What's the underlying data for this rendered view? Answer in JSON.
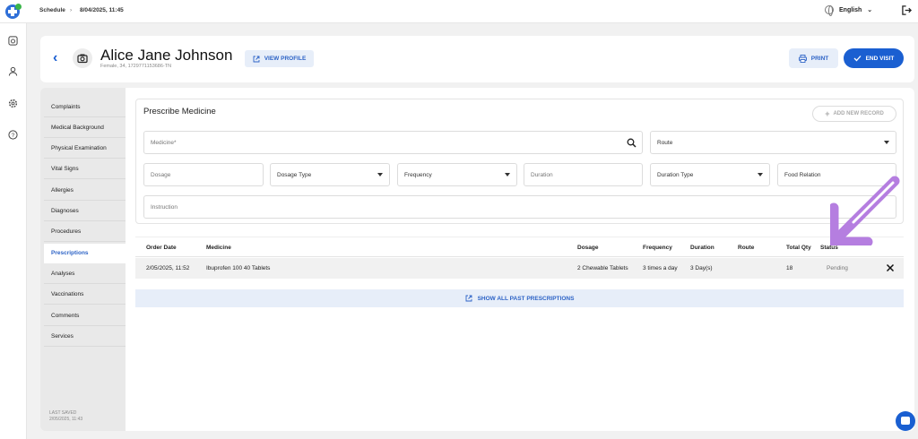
{
  "topbar": {
    "crumb_root": "Schedule",
    "crumb_sep": "›",
    "crumb_current": "8/04/2025, 11:45",
    "language": "English",
    "icons": [
      "app-logo",
      "globe-icon",
      "chevron-down-icon",
      "logout-icon"
    ]
  },
  "rail": {
    "icons": [
      "calendar-icon",
      "user-icon",
      "settings-icon",
      "help-icon"
    ]
  },
  "patient": {
    "name": "Alice Jane Johnson",
    "info": "Female, 34, 1729771153686-TN",
    "view_profile": "VIEW PROFILE"
  },
  "actions": {
    "print": "PRINT",
    "end_visit": "END VISIT"
  },
  "nav": {
    "items": [
      {
        "label": "Complaints"
      },
      {
        "label": "Medical Background"
      },
      {
        "label": "Physical Examination"
      },
      {
        "label": "Vital Signs"
      },
      {
        "label": "Allergies"
      },
      {
        "label": "Diagnoses"
      },
      {
        "label": "Procedures"
      },
      {
        "label": "Prescriptions",
        "active": true
      },
      {
        "label": "Analyses"
      },
      {
        "label": "Vaccinations"
      },
      {
        "label": "Comments"
      },
      {
        "label": "Services"
      }
    ],
    "last_saved_label": "LAST SAVED",
    "last_saved_value": "2/05/2025, 11:43"
  },
  "prescribe": {
    "title": "Prescribe Medicine",
    "add_new": "ADD NEW RECORD",
    "fields": {
      "medicine": "Medicine*",
      "route": "Route",
      "dosage": "Dosage",
      "dosage_type": "Dosage Type",
      "frequency": "Frequency",
      "duration": "Duration",
      "duration_type": "Duration Type",
      "food_relation": "Food Relation",
      "instruction": "Instruction"
    }
  },
  "table": {
    "headers": [
      "Order Date",
      "Medicine",
      "Dosage",
      "Frequency",
      "Duration",
      "Route",
      "Total Qty",
      "Status"
    ],
    "rows": [
      {
        "order_date": "2/05/2025, 11:52",
        "medicine": "Ibuprofen 100 40 Tablets",
        "dosage": "2 Chewable Tablets",
        "frequency": "3 times a day",
        "duration": "3 Day(s)",
        "route": "",
        "total_qty": "18",
        "status": "Pending"
      }
    ],
    "show_all": "SHOW ALL PAST PRESCRIPTIONS"
  },
  "colors": {
    "accent": "#1a5fd1",
    "annotation": "#b57ee0"
  }
}
